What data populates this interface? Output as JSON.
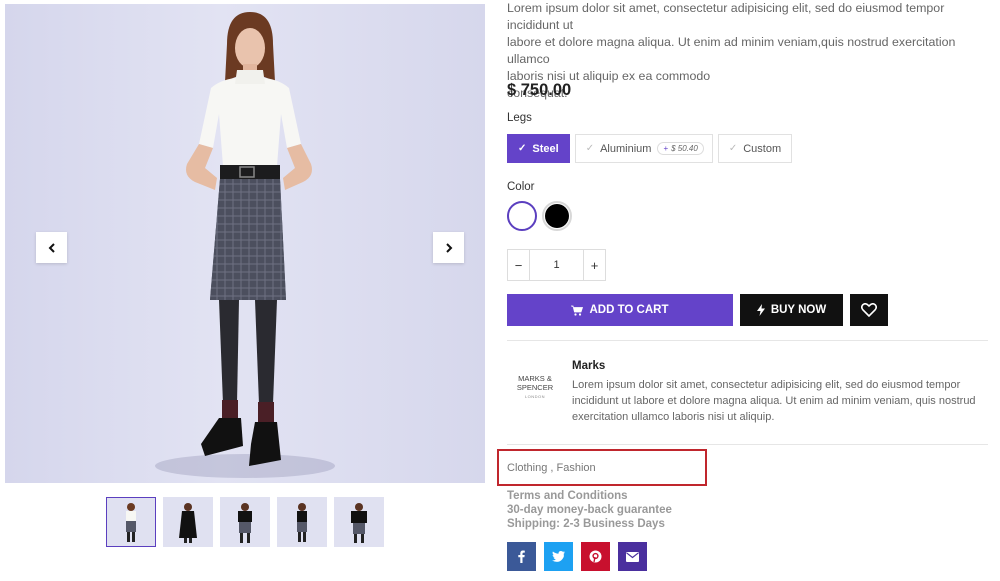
{
  "product": {
    "description_lines": [
      "Lorem ipsum dolor sit amet, consectetur adipisicing elit, sed do eiusmod tempor incididunt ut",
      "labore et dolore magna aliqua. Ut enim ad minim veniam,quis nostrud exercitation ullamco",
      "laboris nisi ut aliquip ex ea commodo",
      "consequat."
    ],
    "price": "$ 750.00"
  },
  "legs": {
    "label": "Legs",
    "options": [
      {
        "label": "Steel",
        "selected": true
      },
      {
        "label": "Aluminium",
        "surcharge": "$ 50.40",
        "selected": false
      },
      {
        "label": "Custom",
        "selected": false
      }
    ]
  },
  "color": {
    "label": "Color",
    "swatches": [
      {
        "name": "white",
        "hex": "#ffffff",
        "selected": true
      },
      {
        "name": "black",
        "hex": "#000000",
        "selected": false
      }
    ]
  },
  "quantity": {
    "minus": "−",
    "value": "1",
    "plus": "+"
  },
  "actions": {
    "add_to_cart": "ADD TO CART",
    "buy_now": "BUY NOW"
  },
  "brand": {
    "logo_line1": "MARKS &",
    "logo_line2": "SPENCER",
    "logo_line3": "LONDON",
    "name": "Marks",
    "description": "Lorem ipsum dolor sit amet, consectetur adipisicing elit, sed do eiusmod tempor incididunt ut labore et dolore magna aliqua. Ut enim ad minim veniam, quis nostrud exercitation ullamco laboris nisi ut aliquip."
  },
  "categories": {
    "first": "Clothing",
    "separator": " , ",
    "second": "Fashion"
  },
  "policy": {
    "terms": "Terms and Conditions",
    "guarantee": "30-day money-back guarantee",
    "shipping": "Shipping: 2-3 Business Days"
  },
  "share": [
    {
      "name": "facebook",
      "color": "#3b5998"
    },
    {
      "name": "twitter",
      "color": "#1da1f2"
    },
    {
      "name": "pinterest",
      "color": "#c8102e"
    },
    {
      "name": "email",
      "color": "#4a2f9e"
    }
  ],
  "colors": {
    "accent": "#6443c9",
    "dark": "#111111",
    "highlight_border": "#c0262d"
  }
}
